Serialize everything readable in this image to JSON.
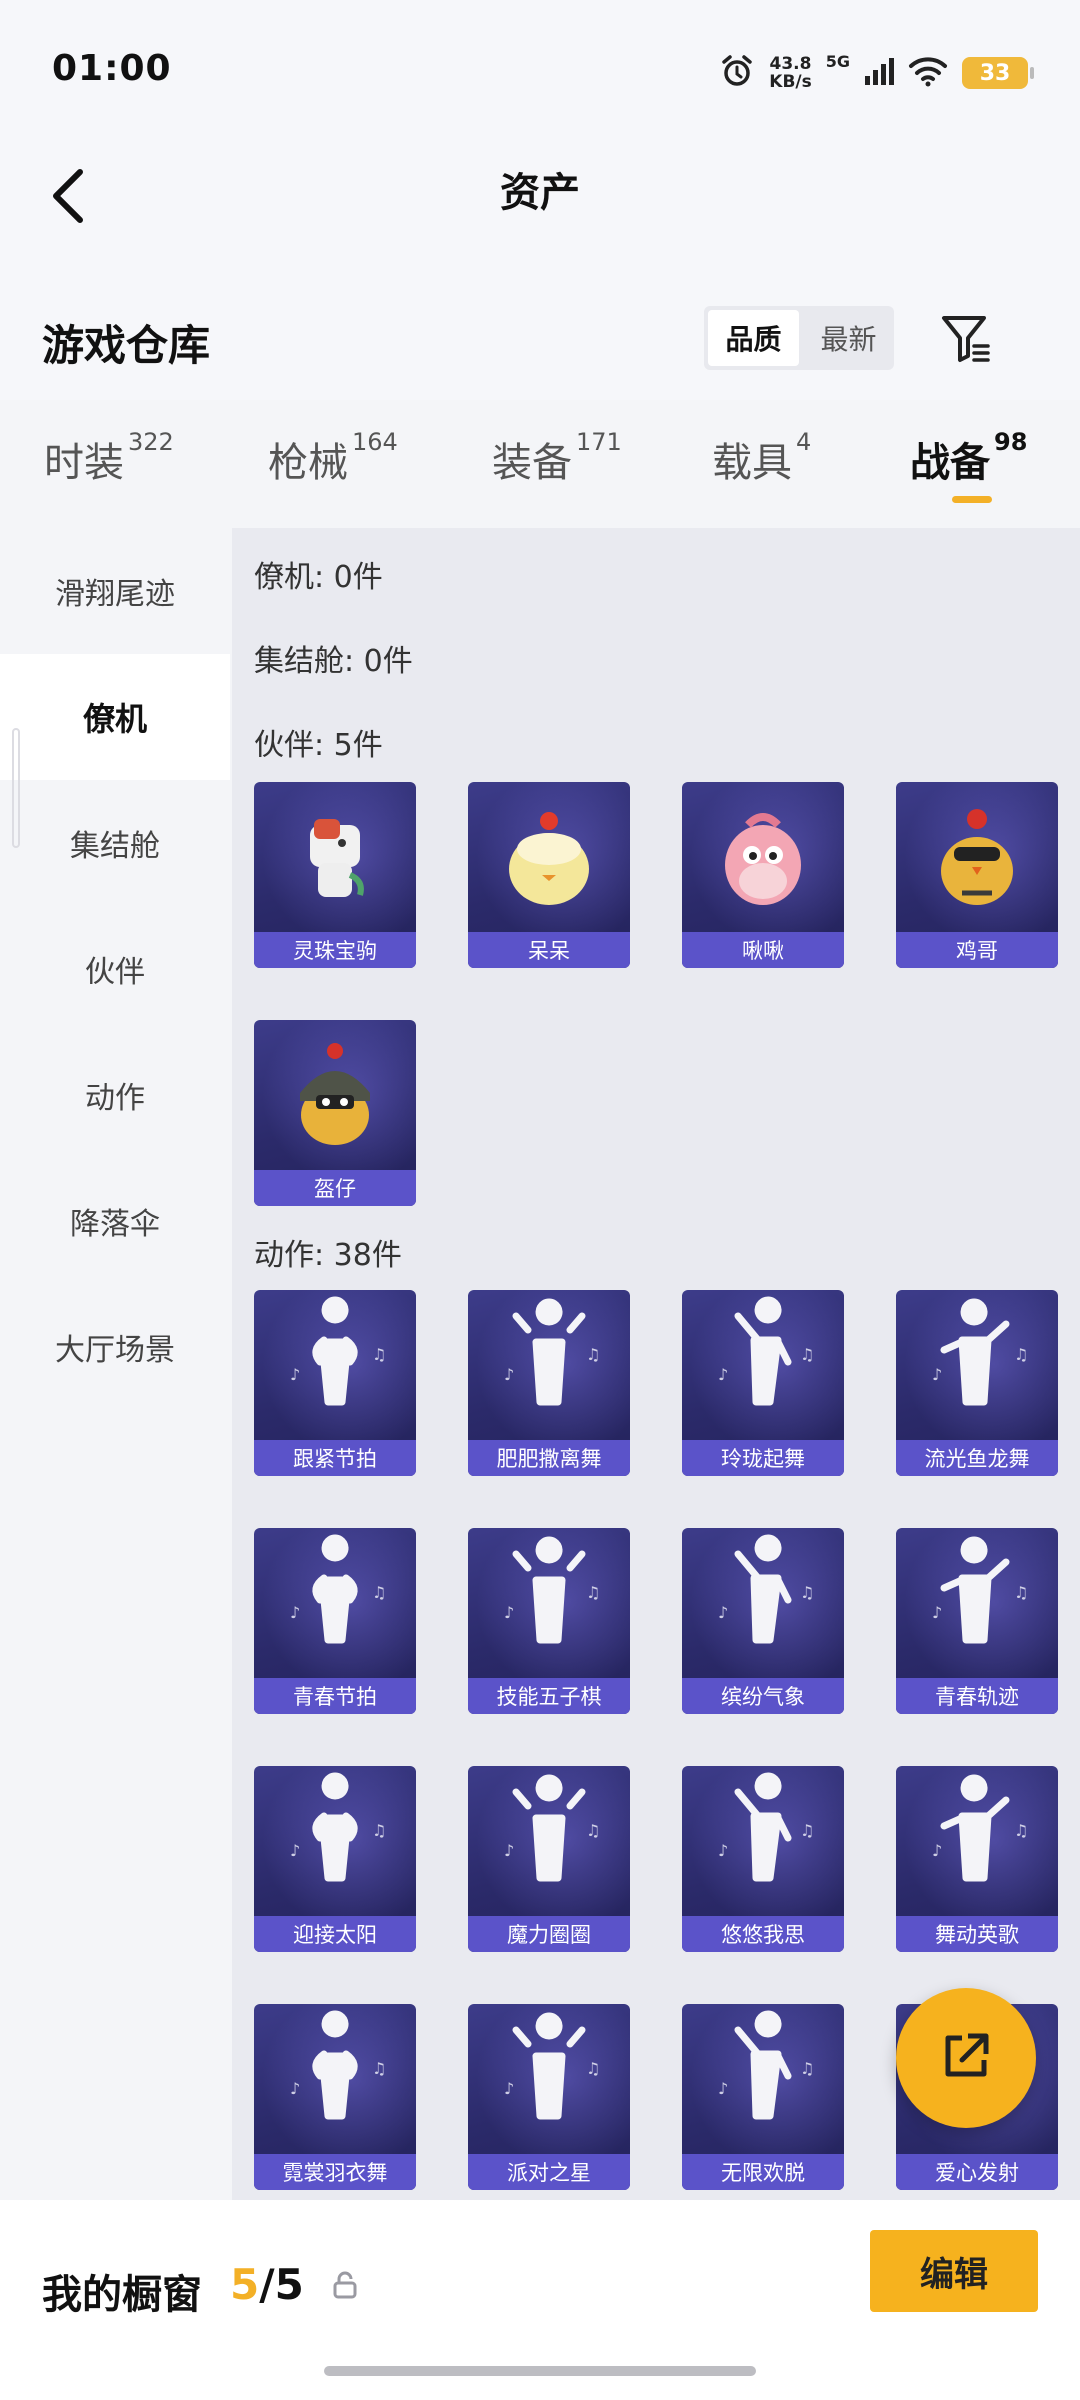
{
  "status_bar": {
    "time": "01:00",
    "net_speed_value": "43.8",
    "net_speed_unit": "KB/s",
    "network": "5G",
    "battery": "33"
  },
  "header": {
    "title": "资产"
  },
  "warehouse": {
    "title": "游戏仓库",
    "sort_options": [
      "品质",
      "最新"
    ],
    "sort_selected": "品质"
  },
  "tabs": [
    {
      "label": "时装",
      "count": "322"
    },
    {
      "label": "枪械",
      "count": "164"
    },
    {
      "label": "装备",
      "count": "171"
    },
    {
      "label": "载具",
      "count": "4"
    },
    {
      "label": "战备",
      "count": "98",
      "active": true
    }
  ],
  "sidebar": {
    "items": [
      "滑翔尾迹",
      "僚机",
      "集结舱",
      "伙伴",
      "动作",
      "降落伞",
      "大厅场景"
    ],
    "active": "僚机"
  },
  "content": {
    "sections": {
      "wingman": "僚机: 0件",
      "pod": "集结舱: 0件",
      "partners": "伙伴: 5件",
      "emotes": "动作: 38件"
    },
    "partners": [
      {
        "name": "灵珠宝驹",
        "icon": "horse-toy-icon"
      },
      {
        "name": "呆呆",
        "icon": "chick-icon"
      },
      {
        "name": "啾啾",
        "icon": "pink-bird-icon"
      },
      {
        "name": "鸡哥",
        "icon": "rooster-sunglasses-icon"
      },
      {
        "name": "盔仔",
        "icon": "helmet-chick-icon"
      }
    ],
    "emotes": [
      {
        "name": "跟紧节拍",
        "icon": "dance-pose-icon"
      },
      {
        "name": "肥肥撒离舞",
        "icon": "dance-pose-icon"
      },
      {
        "name": "玲珑起舞",
        "icon": "dance-pose-icon"
      },
      {
        "name": "流光鱼龙舞",
        "icon": "dance-pose-icon"
      },
      {
        "name": "青春节拍",
        "icon": "dance-pose-icon"
      },
      {
        "name": "技能五子棋",
        "icon": "dance-pose-icon"
      },
      {
        "name": "缤纷气象",
        "icon": "dance-pose-icon"
      },
      {
        "name": "青春轨迹",
        "icon": "dance-pose-icon"
      },
      {
        "name": "迎接太阳",
        "icon": "dance-pose-icon"
      },
      {
        "name": "魔力圈圈",
        "icon": "dance-pose-icon"
      },
      {
        "name": "悠悠我思",
        "icon": "dance-pose-icon"
      },
      {
        "name": "舞动英歌",
        "icon": "dance-pose-icon"
      },
      {
        "name": "霓裳羽衣舞",
        "icon": "dance-pose-icon"
      },
      {
        "name": "派对之星",
        "icon": "dance-pose-icon"
      },
      {
        "name": "无限欢脱",
        "icon": "dance-pose-icon"
      },
      {
        "name": "爱心发射",
        "icon": "dance-pose-icon"
      }
    ]
  },
  "bottom_bar": {
    "showcase_label": "我的橱窗",
    "showcase_used": "5",
    "showcase_total": "/5",
    "edit_label": "编辑"
  },
  "colors": {
    "accent": "#f6b21e",
    "card_label_bg": "#5b53c9",
    "card_bg": "#2f2e72"
  }
}
